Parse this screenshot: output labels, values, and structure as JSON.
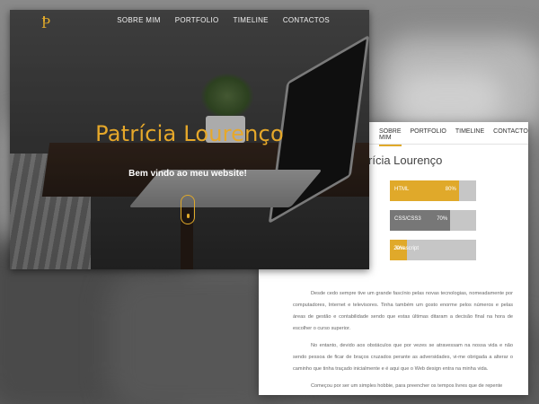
{
  "hero": {
    "logo_letter": "P",
    "nav": [
      "SOBRE MIM",
      "PORTFOLIO",
      "TIMELINE",
      "CONTACTOS"
    ],
    "title": "Patrícia Lourenço",
    "subtitle": "Bem vindo ao meu website!"
  },
  "about": {
    "nav": [
      "SOBRE MIM",
      "PORTFOLIO",
      "TIMELINE",
      "CONTACTOS"
    ],
    "active_tab": "SOBRE MIM",
    "name_visible": "rícia Lourenço",
    "skills": [
      {
        "label": "HTML",
        "percent_text": "80%",
        "level": 80,
        "color": "#e0a92a"
      },
      {
        "label": "CSS/CSS3",
        "percent_text": "70%",
        "level": 70,
        "color": "#777777"
      },
      {
        "label": "Javascript",
        "percent_text": "20%",
        "level": 20,
        "color": "#e0a92a"
      }
    ],
    "paragraphs": [
      "Desde cedo sempre tive um grande fascínio pelas novas tecnologias, nomeadamente por computadores, Internet e televisores. Tinha também um gosto enorme pelos números e pelas áreas de gestão e contabilidade sendo que estas últimas ditaram a decisão final na hora de escolher o curso superior.",
      "No entanto, devido aos obstáculos que por vezes se atravessam na nossa vida e não sendo pessoa de ficar de braços cruzados perante as adversidades, vi-me obrigada a alterar o caminho que tinha traçado inicialmente e é aqui que o Web design entra na minha vida.",
      "Começou por ser um simples hobbie, para preencher os tempos livres que de repente"
    ]
  },
  "colors": {
    "accent": "#e0a92a",
    "grey_bar": "#777777",
    "bar_track": "#c6c6c6"
  }
}
